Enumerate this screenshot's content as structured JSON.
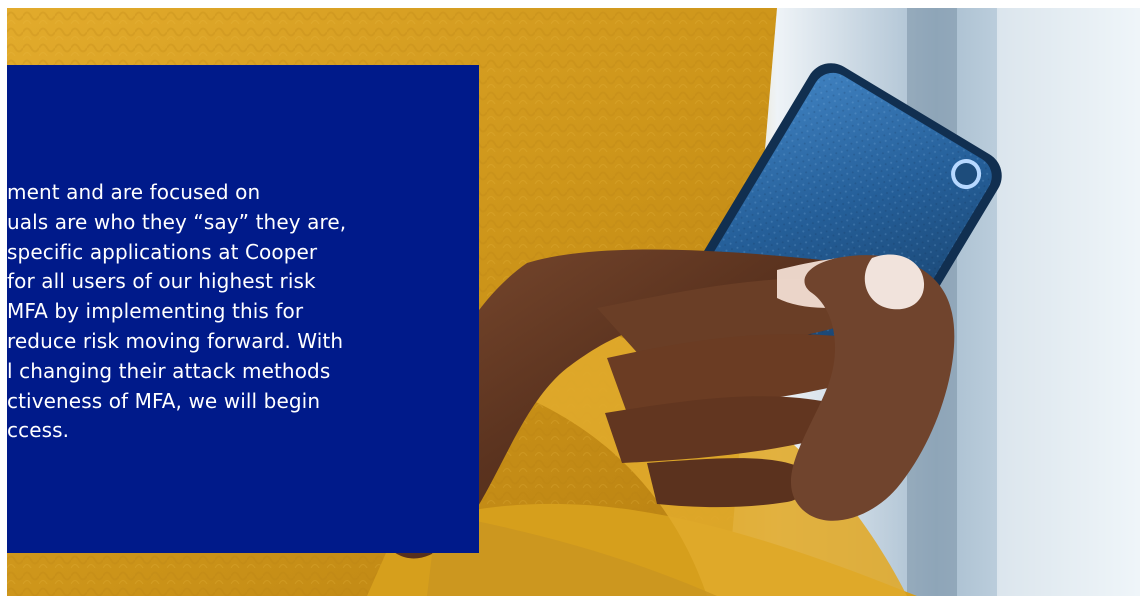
{
  "hero": {
    "image_subject": "person in yellow sweater holding a smartphone"
  },
  "panel": {
    "background_color": "#001a8a",
    "text_color": "#ffffff",
    "lines": [
      "ment and are focused on",
      "uals are who they “say” they are,",
      "specific applications at Cooper",
      " for all users of our highest risk",
      " MFA by implementing this for",
      " reduce risk moving forward. With",
      "l changing their attack methods",
      "ctiveness of MFA, we will begin",
      "ccess."
    ]
  },
  "colors": {
    "sweater": "#d6a21e",
    "phone_case": "#2f6fae",
    "window_light": "#dbe6ee"
  }
}
